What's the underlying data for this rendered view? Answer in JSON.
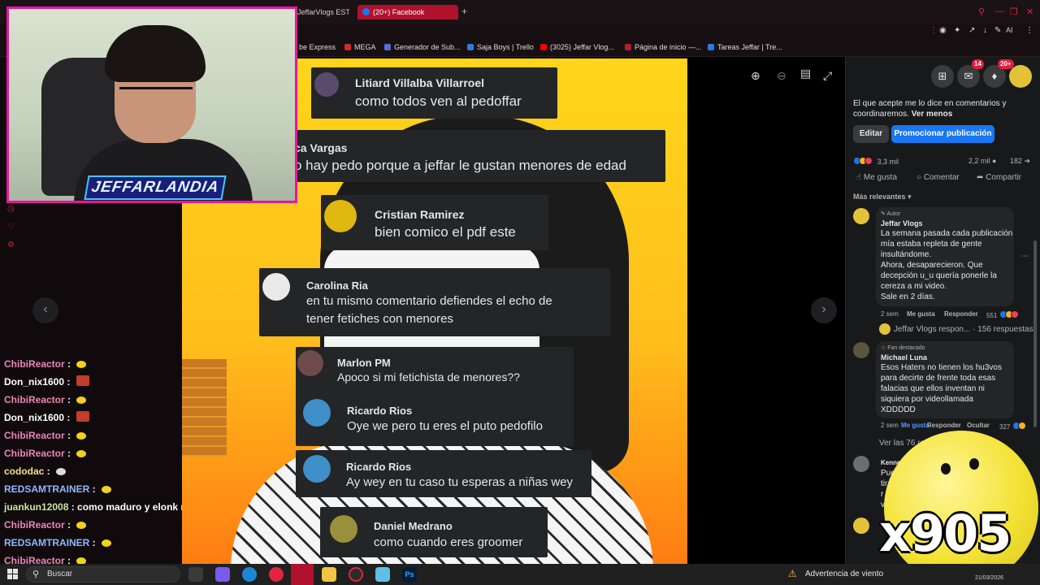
{
  "browser": {
    "tabs": [
      {
        "label": "JeffarVlogs ESTA"
      },
      {
        "label": "(20+) Facebook"
      }
    ],
    "bookmarks": [
      {
        "label": "be Express"
      },
      {
        "label": "MEGA"
      },
      {
        "label": "Generador de Sub..."
      },
      {
        "label": "Saja Boys | Trello"
      },
      {
        "label": "(3025) Jeffar Vlog..."
      },
      {
        "label": "Página de inicio —..."
      },
      {
        "label": "Tareas Jeffar | Tre..."
      }
    ],
    "ai_label": "AI"
  },
  "stream": {
    "overlay_logo": "JEFFARLANDIA",
    "chat": [
      {
        "user": "ChibiReactor",
        "msg": ""
      },
      {
        "user": "Don_nix1600",
        "msg": ""
      },
      {
        "user": "ChibiReactor",
        "msg": ""
      },
      {
        "user": "Don_nix1600",
        "msg": ""
      },
      {
        "user": "ChibiReactor",
        "msg": ""
      },
      {
        "user": "ChibiReactor",
        "msg": ""
      },
      {
        "user": "cododac",
        "msg": ""
      },
      {
        "user": "REDSAMTRAINER",
        "msg": ""
      },
      {
        "user": "juankun12008",
        "msg": "como maduro y elonk mosk"
      },
      {
        "user": "ChibiReactor",
        "msg": ""
      },
      {
        "user": "REDSAMTRAINER",
        "msg": ""
      },
      {
        "user": "ChibiReactor",
        "msg": ""
      }
    ],
    "brand_text": "x905"
  },
  "meme": {
    "comments": [
      {
        "name": "Litiard Villalba Villarroel",
        "text": "como todos ven al pedoffar"
      },
      {
        "name": "ca Vargas",
        "text": "o hay pedo porque a jeffar le gustan menores de edad"
      },
      {
        "name": "Cristian Ramirez",
        "text": "bien comico el pdf este"
      },
      {
        "name": "Carolina Ria",
        "text": "en tu mismo comentario defiendes el echo de",
        "text2": "tener fetiches con menores"
      },
      {
        "name": "Marlon PM",
        "text": "Apoco si mi fetichista de menores??"
      },
      {
        "name": "Ricardo Rios",
        "text": "Oye we pero tu eres el puto pedofilo"
      },
      {
        "name": "Ricardo Rios",
        "text": "Ay wey en tu caso tu esperas a niñas wey"
      },
      {
        "name": "Daniel Medrano",
        "text": "como cuando eres groomer"
      }
    ]
  },
  "facebook": {
    "badges": {
      "messenger": "14",
      "notifications": "20+"
    },
    "post_text": "El que acepte me lo dice en comentarios y coordinaremos.",
    "see_less": "Ver menos",
    "edit_label": "Editar",
    "promote_label": "Promocionar publicación",
    "reactions_count": "3,3 mil",
    "comments_count": "2,2 mil",
    "shares_count": "182",
    "actions": {
      "like": "Me gusta",
      "comment": "Comentar",
      "share": "Compartir"
    },
    "sort_label": "Más relevantes",
    "comments": [
      {
        "badge": "Autor",
        "author": "Jeffar Vlogs",
        "lines": [
          "La semana pasada cada publicación",
          "mía estaba repleta de gente",
          "insultándome.",
          "Ahora, desaparecieron. Que",
          "decepción u_u quería ponerle la",
          "cereza a mi video.",
          "Sale en 2 días."
        ],
        "time": "2 sem",
        "like": "Me gusta",
        "reply": "Responder",
        "count": "551",
        "replies_label": "Jeffar Vlogs respon... · 156 respuestas"
      },
      {
        "badge": "Fan destacado",
        "author": "Michael Luna",
        "lines": [
          "Esos Haters no tienen los hu3vos",
          "para decirte de frente toda esas",
          "falacias que ellos inventan ni",
          "siquiera por videollamada",
          "XDDDDD"
        ],
        "time": "2 sem",
        "like": "Me gusta",
        "reply": "Responder",
        "hide": "Ocultar",
        "count": "327",
        "replies_label": "Ver las 76 resp"
      },
      {
        "author": "Kenne",
        "lines": [
          "Pues",
          "tira",
          "r",
          "v"
        ]
      }
    ]
  },
  "taskbar": {
    "search": "Buscar",
    "weather": "Advertencia de viento",
    "date": "21/03/2026"
  },
  "colors": {
    "accent_red": "#e0233f",
    "facebook_blue": "#1877f2",
    "webcam_border": "#e9159b"
  }
}
